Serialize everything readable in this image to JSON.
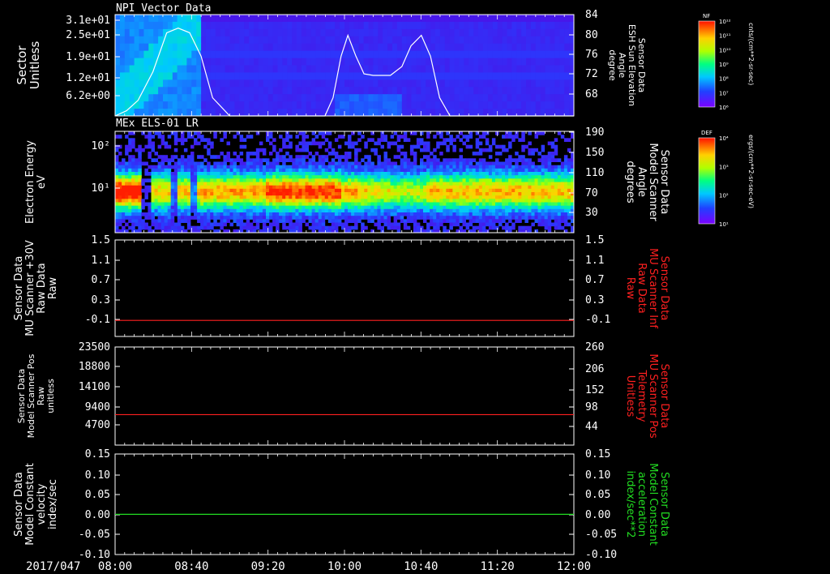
{
  "date_label": "2017/047",
  "time_ticks": [
    "08:00",
    "08:40",
    "09:20",
    "10:00",
    "10:40",
    "11:20",
    "12:00"
  ],
  "colors": {
    "background": "#000000",
    "text": "#ffffff",
    "red": "#ff2020",
    "green": "#22dd22",
    "panel_border": "#ffffff"
  },
  "chart_data": [
    {
      "type": "heatmap",
      "title": "NPI Vector Data",
      "ylabel_lines": [
        "Sector",
        "Unitless"
      ],
      "y_ticks": [
        "3.1e+01",
        "2.5e+01",
        "1.9e+01",
        "1.2e+01",
        "6.2e+00"
      ],
      "right_ylabel_lines": [
        "Sensor Data",
        "ESH Sun Elevation",
        "Angle",
        "degree"
      ],
      "right_y_ticks": [
        "84",
        "80",
        "76",
        "72",
        "68"
      ],
      "overlay_line": {
        "color": "#ffffff",
        "x_hours": [
          8.0,
          8.1,
          8.2,
          8.33,
          8.45,
          8.55,
          8.65,
          8.75,
          8.85,
          9.0,
          9.83,
          9.9,
          9.97,
          10.03,
          10.1,
          10.17,
          10.25,
          10.4,
          10.5,
          10.58,
          10.67,
          10.75,
          10.83,
          10.92,
          12.0
        ],
        "values": [
          64.5,
          65.5,
          67.5,
          73.0,
          80.5,
          81.4,
          80.5,
          76.0,
          68.0,
          64.5,
          64.5,
          68.0,
          76.0,
          80.0,
          76.0,
          72.6,
          72.3,
          72.3,
          74.0,
          78.0,
          80.0,
          76.0,
          68.0,
          64.5,
          64.5
        ],
        "range": [
          64.5,
          84
        ]
      },
      "colorbar": {
        "label": "NF",
        "ticks": [
          "10¹²",
          "10¹¹",
          "10¹⁰",
          "10⁹",
          "10⁸",
          "10⁷",
          "10⁶"
        ],
        "units": "cnts/(cm**2-sr-sec)"
      }
    },
    {
      "type": "heatmap",
      "title": "MEx ELS-01 LR",
      "ylabel_lines": [
        "Electron Energy",
        "eV"
      ],
      "y_ticks": [
        "10²",
        "10¹"
      ],
      "right_ylabel_lines": [
        "Sensor Data",
        "Model Scanner",
        "Angle",
        "degrees"
      ],
      "right_y_ticks": [
        "190",
        "150",
        "110",
        "70",
        "30"
      ],
      "colorbar": {
        "label": "DEF",
        "ticks": [
          "10⁴",
          "10³",
          "10²",
          "10¹"
        ],
        "units": "ergs/(cm**2-sr-sec-eV)"
      }
    },
    {
      "type": "line",
      "ylabel_lines": [
        "Sensor Data",
        "MU Scanner +30V",
        "Raw Data",
        "Raw"
      ],
      "y_ticks": [
        "1.5",
        "1.1",
        "0.7",
        "0.3",
        "-0.1"
      ],
      "right_ylabel_lines": [
        "Sensor Data",
        "MU Scanner Inf",
        "Raw Data",
        "Raw"
      ],
      "right_y_ticks": [
        "1.5",
        "1.1",
        "0.7",
        "0.3",
        "-0.1"
      ],
      "ylim": [
        -0.3,
        1.5
      ],
      "series": [
        {
          "color": "#ff2020",
          "value": 0.0
        }
      ]
    },
    {
      "type": "line",
      "ylabel_lines": [
        "Sensor Data",
        "Model Scanner Pos",
        "Raw",
        "unitless"
      ],
      "y_ticks": [
        "23500",
        "18800",
        "14100",
        "9400",
        "4700"
      ],
      "right_ylabel_lines": [
        "Sensor Data",
        "MU Scanner Pos",
        "Telemetry",
        "Unitless"
      ],
      "right_y_ticks": [
        "260",
        "206",
        "152",
        "98",
        "44"
      ],
      "ylim": [
        0,
        23500
      ],
      "series": [
        {
          "color": "#ff2020",
          "value": 7300
        }
      ]
    },
    {
      "type": "line",
      "ylabel_lines": [
        "Sensor Data",
        "Model Constant",
        "velocity",
        "index/sec"
      ],
      "y_ticks": [
        "0.15",
        "0.10",
        "0.05",
        "0.00",
        "-0.05",
        "-0.10"
      ],
      "right_ylabel_lines": [
        "Sensor Data",
        "Model Constant",
        "acceleration",
        "index/sec**2"
      ],
      "right_y_ticks": [
        "0.15",
        "0.10",
        "0.05",
        "0.00",
        "-0.05",
        "-0.10"
      ],
      "ylim": [
        -0.1,
        0.15
      ],
      "series": [
        {
          "color": "#22dd22",
          "value": 0.0
        }
      ]
    }
  ]
}
